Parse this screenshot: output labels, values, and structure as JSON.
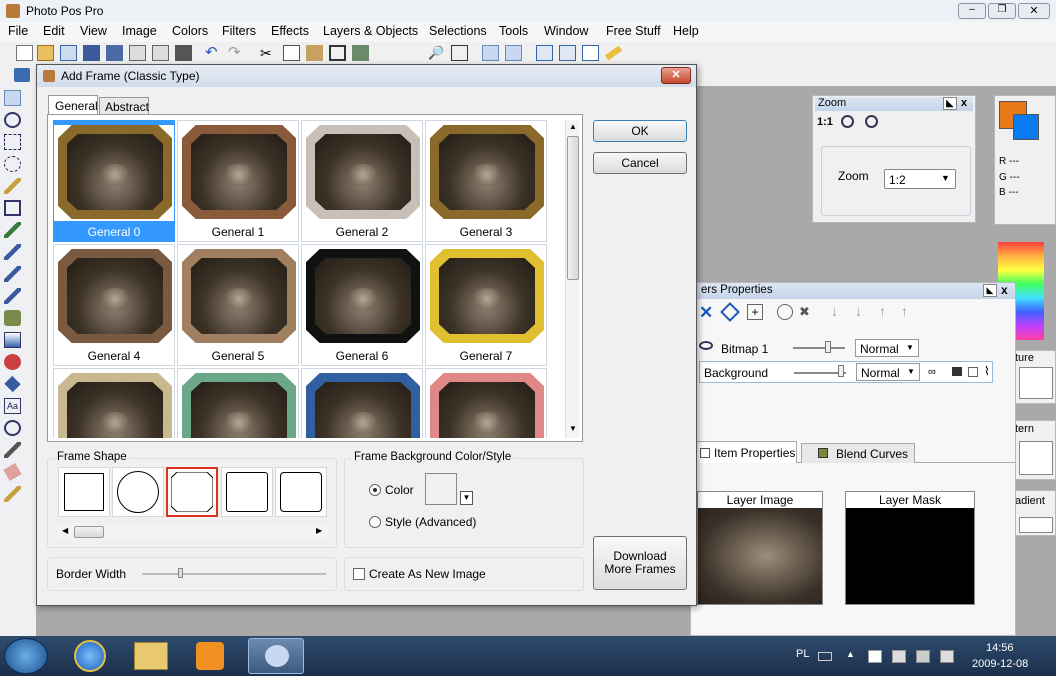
{
  "app": {
    "title": "Photo Pos Pro",
    "menu": [
      "File",
      "Edit",
      "View",
      "Image",
      "Colors",
      "Filters",
      "Effects",
      "Layers & Objects",
      "Selections",
      "Tools",
      "Window",
      "Free Stuff",
      "Help"
    ]
  },
  "dialog": {
    "title": "Add Frame (Classic Type)",
    "tabs": [
      "General",
      "Abstract"
    ],
    "ok": "OK",
    "cancel": "Cancel",
    "frames": [
      {
        "name": "General 0",
        "color": "#8a6a2a"
      },
      {
        "name": "General 1",
        "color": "#8a5a3a"
      },
      {
        "name": "General 2",
        "color": "#c8c0b8"
      },
      {
        "name": "General 3",
        "color": "#8a6a2a"
      },
      {
        "name": "General 4",
        "color": "#7a5a40"
      },
      {
        "name": "General 5",
        "color": "#a08060"
      },
      {
        "name": "General 6",
        "color": "#111111"
      },
      {
        "name": "General 7",
        "color": "#e0c030"
      },
      {
        "name": "",
        "color": "#c8b890"
      },
      {
        "name": "",
        "color": "#6aa888"
      },
      {
        "name": "",
        "color": "#3060a0"
      },
      {
        "name": "",
        "color": "#e08888"
      }
    ],
    "frame_shape_label": "Frame Shape",
    "bg_label": "Frame Background Color/Style",
    "color_option": "Color",
    "style_option": "Style (Advanced)",
    "border_width": "Border Width",
    "create_new": "Create As New Image",
    "download": "Download More Frames"
  },
  "zoom": {
    "title": "Zoom",
    "ratio": "1:1",
    "label": "Zoom",
    "value": "1:2"
  },
  "colors": {
    "r": "R ---",
    "g": "G ---",
    "b": "B ---"
  },
  "side_labels": {
    "texture": "ture",
    "pattern": "tern",
    "gradient": "adient"
  },
  "layers": {
    "title": "ers Properties",
    "rows": [
      {
        "name": "Bitmap 1",
        "mode": "Normal"
      },
      {
        "name": "Background",
        "mode": "Normal"
      }
    ],
    "tabs": [
      "Item Properties",
      "Blend Curves"
    ],
    "layer_image": "Layer Image",
    "layer_mask": "Layer Mask"
  },
  "taskbar": {
    "lang": "PL",
    "time": "14:56",
    "date": "2009-12-08"
  }
}
